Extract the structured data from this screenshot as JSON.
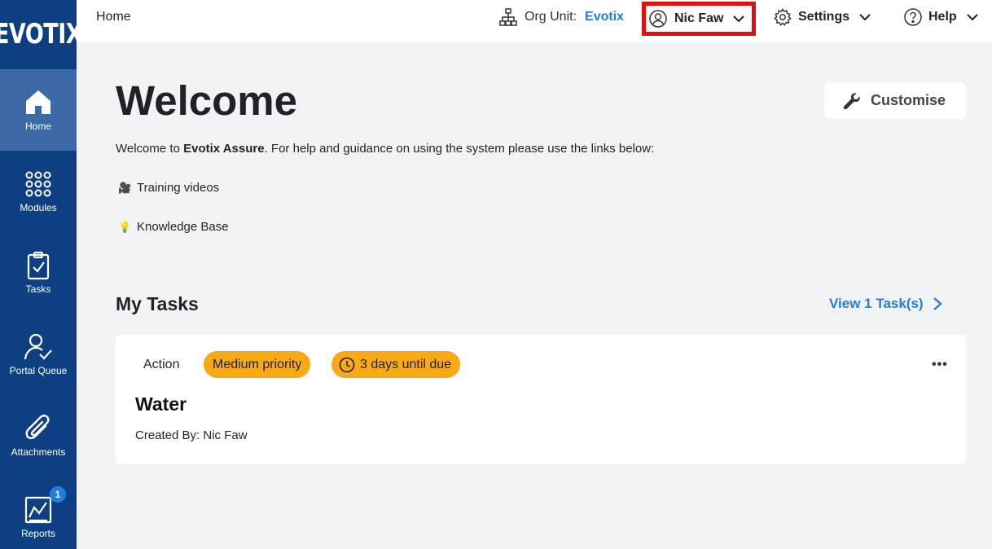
{
  "brand": {
    "logo_text": "EVOTIX"
  },
  "sidebar": {
    "items": [
      {
        "label": "Home",
        "icon": "home-icon",
        "active": true
      },
      {
        "label": "Modules",
        "icon": "grid-dots-icon"
      },
      {
        "label": "Tasks",
        "icon": "clipboard-check-icon"
      },
      {
        "label": "Portal Queue",
        "icon": "user-check-icon"
      },
      {
        "label": "Attachments",
        "icon": "paperclip-icon"
      },
      {
        "label": "Reports",
        "icon": "chart-report-icon",
        "badge": "1"
      }
    ]
  },
  "topbar": {
    "breadcrumb": "Home",
    "org_label": "Org Unit:",
    "org_value": "Evotix",
    "user_name": "Nic Faw",
    "settings_label": "Settings",
    "help_label": "Help"
  },
  "main": {
    "title": "Welcome",
    "customise_label": "Customise",
    "welcome_prefix": "Welcome to ",
    "welcome_brand": "Evotix Assure",
    "welcome_suffix": ". For help and guidance on using the system please use the links below:",
    "links": [
      {
        "emoji": "🎥",
        "label": "Training videos"
      },
      {
        "emoji": "💡",
        "label": "Knowledge Base"
      }
    ]
  },
  "tasks": {
    "heading": "My Tasks",
    "view_link": "View 1 Task(s)",
    "card": {
      "type": "Action",
      "priority": "Medium priority",
      "due": "3 days until due",
      "more": "•••",
      "title": "Water",
      "created_by": "Created By: Nic Faw"
    }
  },
  "colors": {
    "sidebar": "#0e3f82",
    "sidebar_active": "#3d6aa6",
    "accent": "#1e7fe0",
    "pill": "#f7a916",
    "highlight": "#e01010"
  }
}
